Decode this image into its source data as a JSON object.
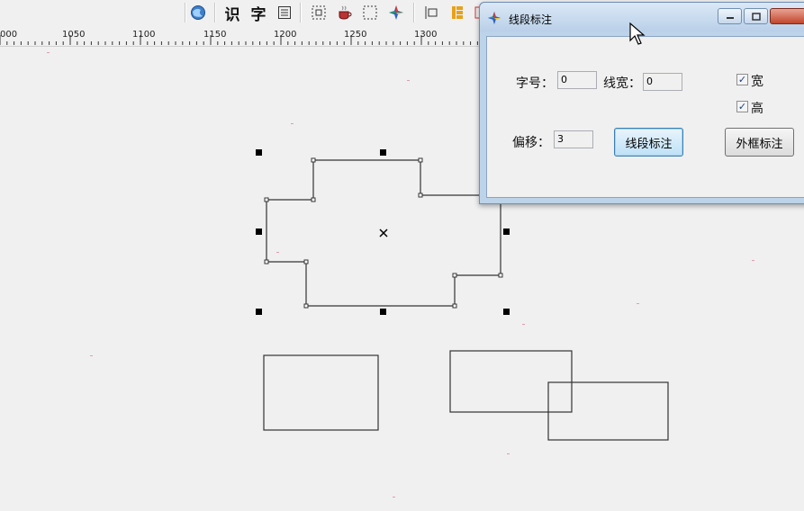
{
  "toolbar": {
    "text_recognize": "识",
    "text_char": "字"
  },
  "ruler": {
    "labels": [
      "000",
      "1050",
      "1100",
      "1150",
      "1200",
      "1250",
      "1300"
    ]
  },
  "dialog": {
    "title": "线段标注",
    "font_size_label": "字号：",
    "font_size_value": "0",
    "line_width_label": "线宽：",
    "line_width_value": "0",
    "offset_label": "偏移：",
    "offset_value": "3",
    "width_checkbox_label": "宽",
    "height_checkbox_label": "高",
    "width_checked": true,
    "height_checked": true,
    "segment_button": "线段标注",
    "frame_button": "外框标注"
  },
  "icons": {
    "toolbar": [
      "globe-icon",
      "recognize-text-icon",
      "char-text-icon",
      "table-icon",
      "select-frame-icon",
      "cup-icon",
      "dashed-select-icon",
      "color-star-icon",
      "align-icon",
      "layers-icon",
      "frame-icon"
    ],
    "dialog": [
      "app-star-icon",
      "minimize-icon",
      "maximize-icon",
      "close-icon"
    ],
    "canvas": [
      "center-cross-icon"
    ]
  },
  "colors": {
    "canvas_bg": "#f0f0f0",
    "shape_stroke": "#333333",
    "handle_fill": "#000000",
    "dialog_frame": "#bcd3ea"
  }
}
